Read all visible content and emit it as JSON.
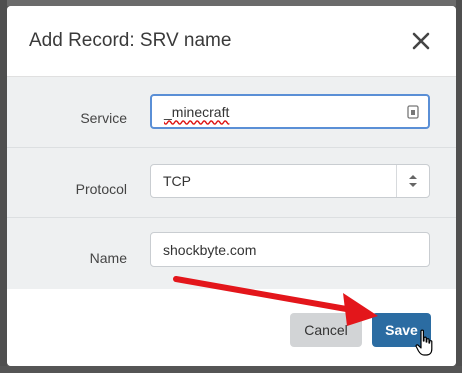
{
  "dialog": {
    "title": "Add Record: SRV name",
    "close_icon": "close-icon"
  },
  "form": {
    "service": {
      "label": "Service",
      "value": "_minecraft"
    },
    "protocol": {
      "label": "Protocol",
      "value": "TCP"
    },
    "name": {
      "label": "Name",
      "value": "shockbyte.com"
    }
  },
  "footer": {
    "cancel_label": "Cancel",
    "save_label": "Save"
  },
  "colors": {
    "save_button": "#2b6ca2",
    "cancel_button": "#d2d4d6",
    "arrow": "#e3161b",
    "focus_border": "#5a8fd6"
  }
}
